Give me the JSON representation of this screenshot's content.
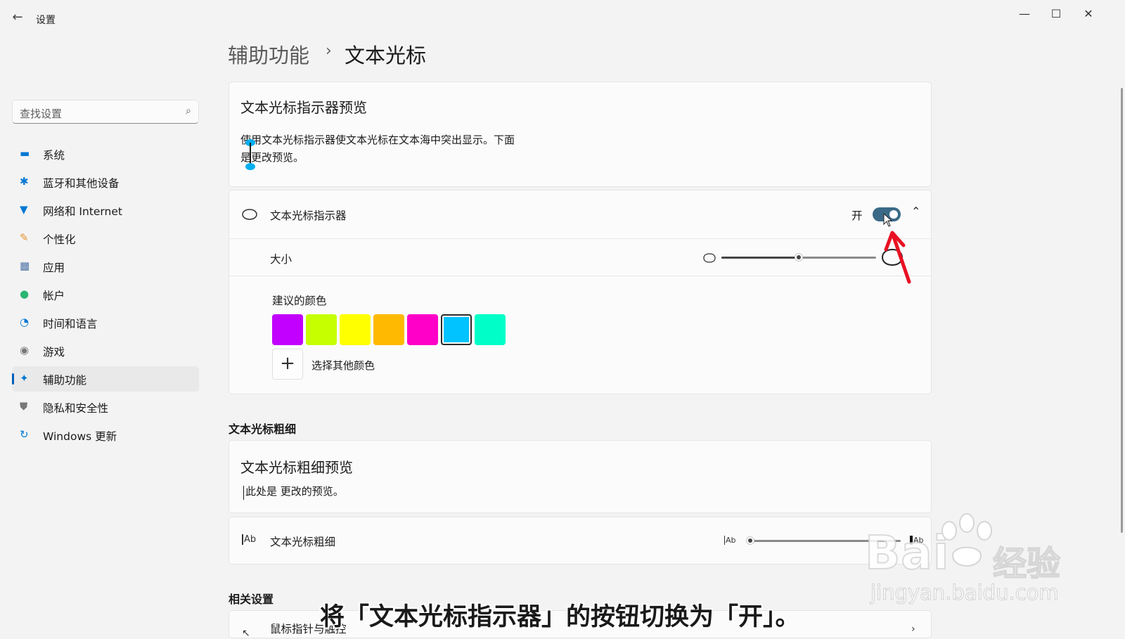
{
  "app": {
    "title": "设置"
  },
  "window_controls": {
    "minimize": "—",
    "maximize": "☐",
    "close": "✕"
  },
  "search": {
    "placeholder": "查找设置"
  },
  "sidebar": {
    "items": [
      {
        "label": "系统",
        "icon": "system-icon",
        "color": "#0078d4"
      },
      {
        "label": "蓝牙和其他设备",
        "icon": "bluetooth-icon",
        "color": "#0078d4"
      },
      {
        "label": "网络和 Internet",
        "icon": "wifi-icon",
        "color": "#0078d4"
      },
      {
        "label": "个性化",
        "icon": "brush-icon",
        "color": "#e8912d"
      },
      {
        "label": "应用",
        "icon": "apps-icon",
        "color": "#4a6fa5"
      },
      {
        "label": "帐户",
        "icon": "account-icon",
        "color": "#2bb673"
      },
      {
        "label": "时间和语言",
        "icon": "globe-clock-icon",
        "color": "#0078d4"
      },
      {
        "label": "游戏",
        "icon": "gamepad-icon",
        "color": "#777777"
      },
      {
        "label": "辅助功能",
        "icon": "accessibility-icon",
        "color": "#0078d4",
        "selected": true
      },
      {
        "label": "隐私和安全性",
        "icon": "shield-icon",
        "color": "#777777"
      },
      {
        "label": "Windows 更新",
        "icon": "update-icon",
        "color": "#0078d4"
      }
    ]
  },
  "breadcrumb": {
    "parent": "辅助功能",
    "separator": "›",
    "current": "文本光标"
  },
  "preview_card": {
    "title": "文本光标指示器预览",
    "line1": "使用文本光标指示器使文本光标在文本海中突出显示。下面",
    "line2": "是更改预览。"
  },
  "indicator": {
    "label": "文本光标指示器",
    "state_text": "开",
    "toggle_on": true,
    "size_label": "大小",
    "size_value": 0.5,
    "colors_label": "建议的颜色",
    "colors": [
      "#c200ff",
      "#c5ff00",
      "#ffff00",
      "#ffb900",
      "#ff00c8",
      "#00c3ff",
      "#00ffc8"
    ],
    "selected_color_index": 5,
    "choose_other": "选择其他颜色",
    "add_symbol": "+"
  },
  "thickness": {
    "section_title": "文本光标粗细",
    "preview_title": "文本光标粗细预览",
    "preview_text": "此处是 更改的预览。",
    "label": "文本光标粗细",
    "icon_text": "Ab",
    "value": 0.0
  },
  "related": {
    "section_title": "相关设置",
    "item_label": "鼠标指针与触控"
  },
  "caption": "将「文本光标指示器」的按钮切换为「开」。",
  "watermark": {
    "brand": "Bai",
    "cn": "经验",
    "url": "jingyan.baidu.com"
  }
}
